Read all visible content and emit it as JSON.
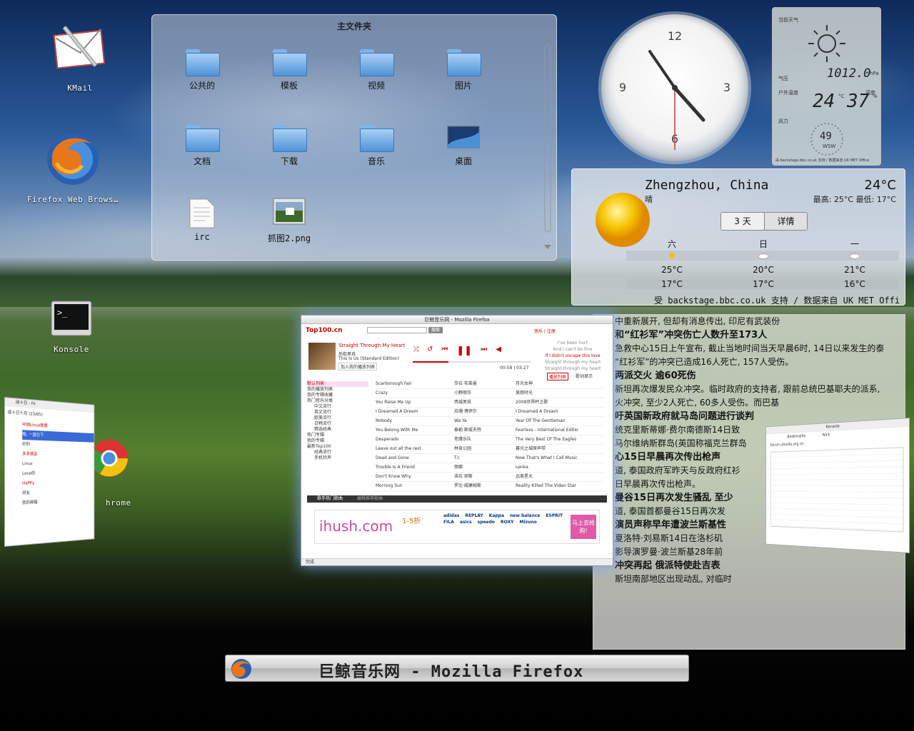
{
  "desktop": {
    "icons": [
      {
        "label": "KMail"
      },
      {
        "label": "Firefox Web Brows…"
      },
      {
        "label": "Konsole"
      },
      {
        "label": "hrome"
      }
    ]
  },
  "folderview": {
    "title": "主文件夹",
    "items": [
      "公共的",
      "模板",
      "视频",
      "图片",
      "文档",
      "下载",
      "音乐",
      "桌面",
      "irc",
      "抓图2.png"
    ]
  },
  "clock": {
    "numerals": [
      "12",
      "3",
      "6",
      "9"
    ]
  },
  "station": {
    "title": "当前天气",
    "pressure_label": "气压",
    "pressure": "1012.0",
    "pressure_unit": "hPa",
    "outdoor_label": "户外温度",
    "humidity_label": "湿度",
    "temp": "24",
    "temp_unit": "°C",
    "humidity": "37",
    "humidity_unit": "%",
    "wind_label": "风力",
    "wind": "49",
    "wind_dir": "WSW",
    "credit": "由 backstage.bbc.co.uk 支持 / 数据来自 UK MET Office"
  },
  "forecast": {
    "city": "Zhengzhou, China",
    "temp": "24°C",
    "condition": "晴",
    "hilo": "最高: 25°C 最低: 17°C",
    "tab_days": "3 天",
    "tab_details": "详情",
    "days": [
      {
        "day": "六",
        "high": "25°C",
        "low": "17°C"
      },
      {
        "day": "日",
        "high": "20°C",
        "low": "17°C"
      },
      {
        "day": "一",
        "high": "21°C",
        "low": "16°C"
      }
    ],
    "credit": "受 backstage.bbc.co.uk 支持 / 数据来自 UK MET Offic"
  },
  "news": {
    "lines": [
      {
        "t": "中重新展开, 但却有消息传出, 印尼有武装份",
        "h": false
      },
      {
        "t": "和“红衫军”冲突伤亡人数升至173人",
        "h": true
      },
      {
        "t": "急救中心15日上午宣布, 截止当地时间当天早晨6时, 14日以来发生的泰",
        "h": false
      },
      {
        "t": "“红衫军”的冲突已造成16人死亡, 157人受伤。",
        "h": false
      },
      {
        "t": "两派交火 逾60死伤",
        "h": true
      },
      {
        "t": "新坦再次爆发民众冲突。临时政府的支持者, 跟前总统巴基耶夫的派系,",
        "h": false
      },
      {
        "t": "火冲突, 至少2人死亡, 60多人受伤。而巴基",
        "h": false
      },
      {
        "t": "吁英国新政府就马岛问题进行谈判",
        "h": true
      },
      {
        "t": "统克里斯蒂娜·费尔南德斯14日致",
        "h": false
      },
      {
        "t": "马尔维纳斯群岛(英国称福克兰群岛",
        "h": false
      },
      {
        "t": "心15日早晨再次传出枪声",
        "h": true
      },
      {
        "t": "道, 泰国政府军昨天与反政府红衫",
        "h": false
      },
      {
        "t": "日早晨再次传出枪声。",
        "h": false
      },
      {
        "t": "曼谷15日再次发生骚乱 至少",
        "h": true
      },
      {
        "t": "道, 泰国首都曼谷15日再次发",
        "h": false
      },
      {
        "t": "演员声称早年遭波兰斯基性",
        "h": true
      },
      {
        "t": "夏洛特·刘易斯14日在洛杉矶",
        "h": false
      },
      {
        "t": "影导演罗曼·波兰斯基28年前",
        "h": false
      },
      {
        "t": "冲突再起 俄派特使赴吉表",
        "h": true
      },
      {
        "t": "斯坦南部地区出现动乱, 对临时",
        "h": false
      }
    ]
  },
  "firefox": {
    "title": "巨鲸音乐网 - Mozilla Firefox",
    "site_logo": "Top100.cn",
    "search_btn": "搜索",
    "login": "快乐 | 注册",
    "now_playing": "Straight Through My Heart",
    "artist": "后街男孩",
    "album": "This Is Us (Standard Edition)",
    "add_btn": "加入我的播放列表",
    "time": "00:58 | 03:27",
    "lyrics": [
      "I've been hurt",
      "And I can't be fine",
      "If I didn't escape this love",
      "Straight through my heart",
      "Straight through my heart"
    ],
    "tab_playlist": "播放列表",
    "tab_lyrics": "歌词显示",
    "sidebar": [
      "默认列表",
      "我的播放列表",
      "我的专辑收藏",
      "热门音乐分类",
      "中文流行",
      "英文流行",
      "欧美流行",
      "日韩流行",
      "精选经典",
      "热门专辑",
      "我的专辑",
      "最新Top100",
      "经典流行",
      "手机铃声"
    ],
    "songs": [
      {
        "title": "Scarborough Fair",
        "artist": "莎拉·布莱曼",
        "album": "月光女神"
      },
      {
        "title": "Crazy",
        "artist": "小野丽莎",
        "album": "美丽时光"
      },
      {
        "title": "You Raise Me Up",
        "artist": "西城男孩",
        "album": "2008世界杯之歌"
      },
      {
        "title": "I Dreamed A Dream",
        "artist": "苏珊·博伊尔",
        "album": "I Dreamed A Dream"
      },
      {
        "title": "Nobody",
        "artist": "Wa Ya",
        "album": "Year Of The Gentleman"
      },
      {
        "title": "You Belong With Me",
        "artist": "泰勒·斯威夫特",
        "album": "Fearless - International Editio"
      },
      {
        "title": "Desperado",
        "artist": "老鹰乐队",
        "album": "The Very Best Of The Eagles"
      },
      {
        "title": "Leave out all the rest",
        "artist": "林肯公园",
        "album": "暮光之城原声带"
      },
      {
        "title": "Dead and Gone",
        "artist": "T.I.",
        "album": "Now That's What I Call Music"
      },
      {
        "title": "Trouble Is A Friend",
        "artist": "丽娜",
        "album": "Lenka"
      },
      {
        "title": "Don't Know Why",
        "artist": "诺拉·琼斯",
        "album": "远离星光"
      },
      {
        "title": "Morning Sun",
        "artist": "罗比·威廉姆斯",
        "album": "Reality Killed The Video Star"
      }
    ],
    "bottom_tabs": [
      "歌手热门歌曲",
      "编辑推荐歌曲"
    ],
    "ad_brand": "ihush.com",
    "ad_discount": "1-5折",
    "ad_cta": "马上去抢购!",
    "brands": [
      "adidas",
      "REPLAY",
      "Kappa",
      "new balance",
      "ESPRIT",
      "FILA",
      "asics",
      "speedo",
      "ROXY",
      "Mizuno"
    ],
    "status": "完成"
  },
  "qq": {
    "title": "阅十日 - Fir",
    "user": "续十日十月",
    "count": "(23/85)",
    "groups": [
      "中国Linux联盟",
      "哦, 一直在下",
      "好的",
      "多多朋友",
      "Linux",
      "Love你",
      "HaPPy",
      "研友",
      "我的邮箱"
    ]
  },
  "konsole_win": {
    "title": "Konsole",
    "tabs": [
      "Bookmarks",
      "Nick"
    ],
    "url": "forum.ubuntu.org.cn"
  },
  "taskbar": {
    "title": "巨鲸音乐网 - Mozilla Firefox"
  }
}
